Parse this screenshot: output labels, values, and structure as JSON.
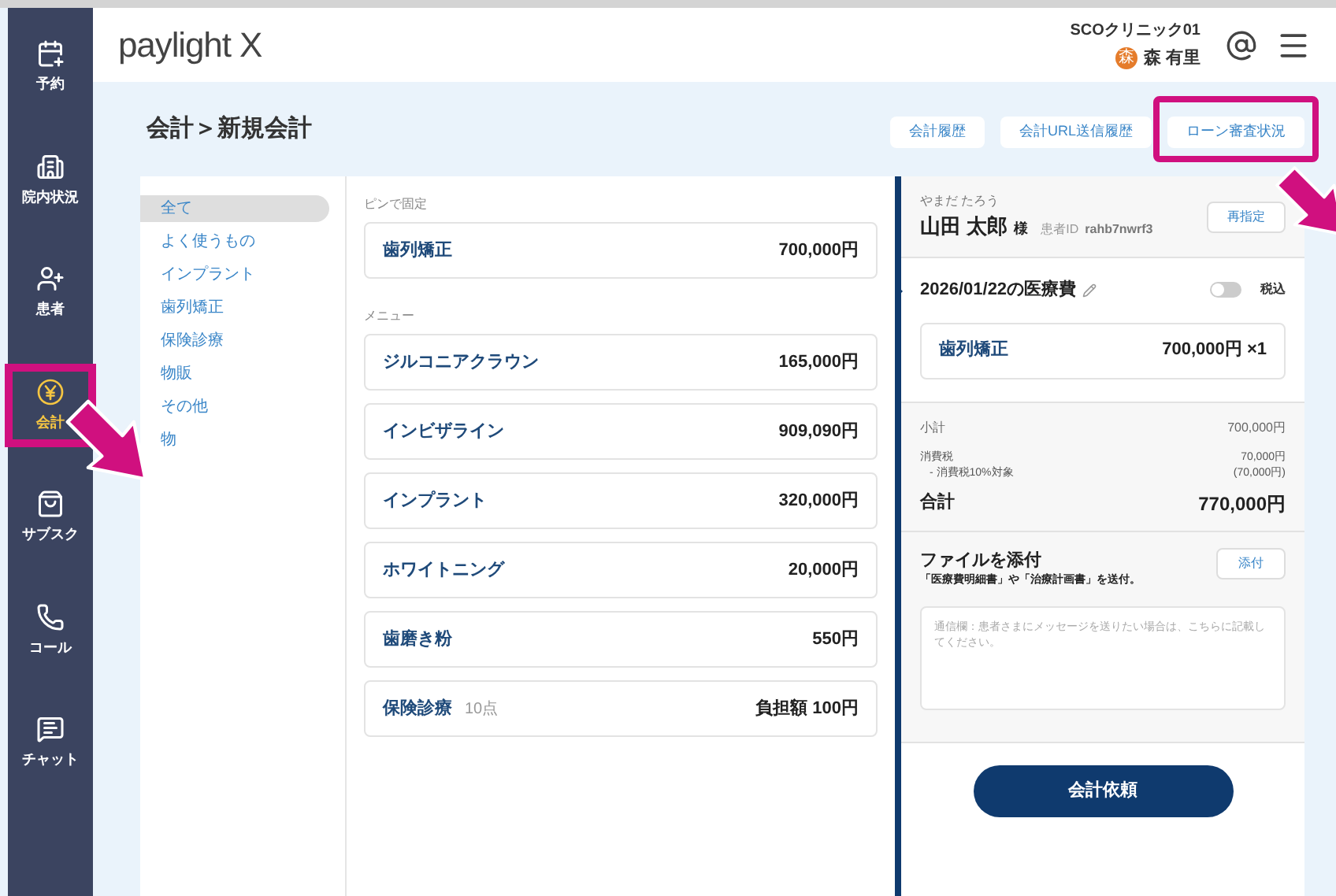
{
  "sidebar": {
    "items": [
      {
        "kind": "calendar",
        "label": "予約",
        "selected": false
      },
      {
        "kind": "building",
        "label": "院内状況",
        "selected": false
      },
      {
        "kind": "user",
        "label": "患者",
        "selected": false
      },
      {
        "kind": "yen",
        "label": "会計",
        "selected": true
      },
      {
        "kind": "bag",
        "label": "サブスク",
        "selected": false
      },
      {
        "kind": "phone",
        "label": "コール",
        "selected": false
      },
      {
        "kind": "chat",
        "label": "チャット",
        "selected": false
      }
    ]
  },
  "header": {
    "logo": "paylight X",
    "clinic": "SCOクリニック01",
    "avatar_text": "森",
    "user": "森 有里"
  },
  "page": {
    "breadcrumb": "会計＞新規会計",
    "buttons": [
      {
        "label": "会計履歴",
        "highlighted": false
      },
      {
        "label": "会計URL送信履歴",
        "highlighted": false
      },
      {
        "label": "ローン審査状況",
        "highlighted": true
      }
    ]
  },
  "categories": [
    {
      "label": "全て",
      "selected": true
    },
    {
      "label": "よく使うもの",
      "selected": false
    },
    {
      "label": "インプラント",
      "selected": false
    },
    {
      "label": "歯列矯正",
      "selected": false
    },
    {
      "label": "保険診療",
      "selected": false
    },
    {
      "label": "物販",
      "selected": false
    },
    {
      "label": "その他",
      "selected": false
    },
    {
      "label": "物",
      "selected": false
    }
  ],
  "pinned": {
    "heading": "ピンで固定",
    "items": [
      {
        "name": "歯列矯正",
        "price": "700,000円"
      }
    ]
  },
  "menu": {
    "heading": "メニュー",
    "items": [
      {
        "name": "ジルコニアクラウン",
        "price": "165,000円"
      },
      {
        "name": "インビザライン",
        "price": "909,090円"
      },
      {
        "name": "インプラント",
        "price": "320,000円"
      },
      {
        "name": "ホワイトニング",
        "price": "20,000円"
      },
      {
        "name": "歯磨き粉",
        "price": "550円"
      },
      {
        "name": "保険診療",
        "points": "10点",
        "price": "負担額 100円"
      }
    ]
  },
  "patient": {
    "kana": "やまだ たろう",
    "name": "山田 太郎",
    "honorific": "様",
    "id_label": "患者ID",
    "id": "rahb7nwrf3",
    "button": "再指定"
  },
  "bill": {
    "title": "2026/01/22の医療費",
    "tax_toggle": {
      "label": "税込",
      "on": false
    },
    "items": [
      {
        "name": "歯列矯正",
        "price": "700,000円 ×1"
      }
    ],
    "subtotal_label": "小計",
    "subtotal": "700,000円",
    "tax_label": "消費税",
    "tax": "70,000円",
    "tax_note_label": "- 消費税10%対象",
    "tax_note": "(70,000円)",
    "total_label": "合計",
    "total": "770,000円"
  },
  "attach": {
    "title": "ファイルを添付",
    "note": "「医療費明細書」や「治療計画書」を送付。",
    "button": "添付",
    "message_placeholder": "通信欄：患者さまにメッセージを送りたい場合は、こちらに記載してください。"
  },
  "submit": "会計依頼"
}
